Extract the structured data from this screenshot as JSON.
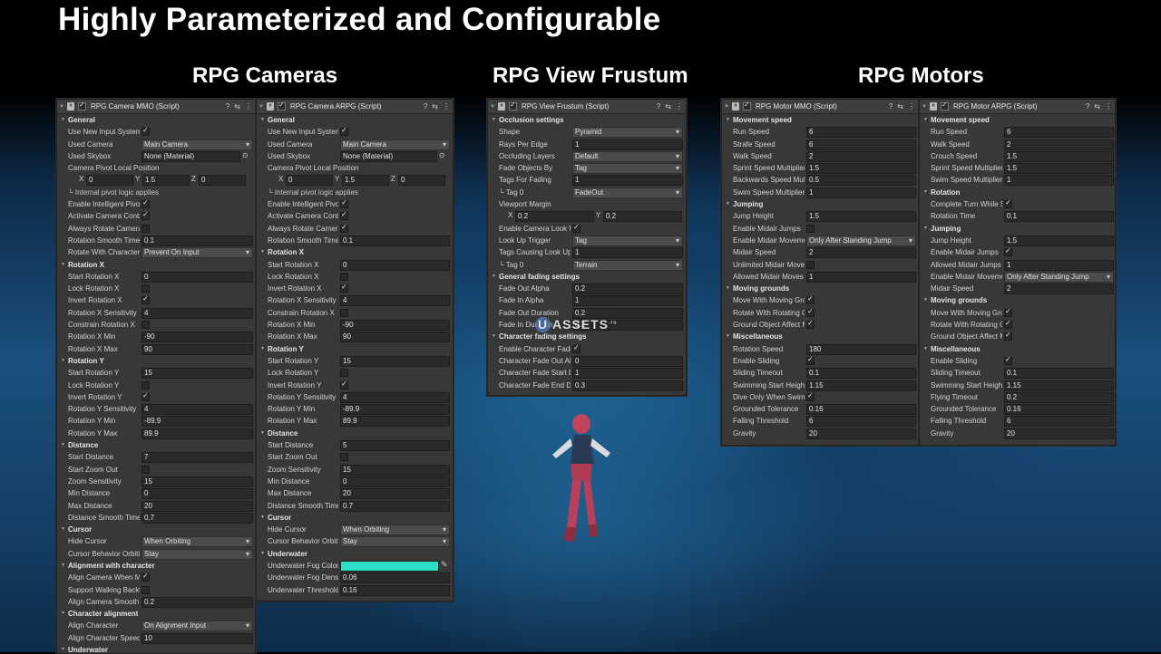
{
  "page": {
    "title": "Highly Parameterized and Configurable",
    "sections": [
      "RPG Cameras",
      "RPG View Frustum",
      "RPG Motors"
    ]
  },
  "colors": {
    "panel_bg": "#383838",
    "field_bg": "#2a2a2a",
    "underwater_fog_color": "#2ee0c8"
  },
  "icons": {
    "header": [
      "help-icon",
      "preset-icon",
      "menu-icon"
    ]
  },
  "watermark": {
    "u": "U",
    "text": "ASSETS",
    "sup": ".ru"
  },
  "panels": [
    {
      "name": "camera-mmo",
      "title": "RPG Camera MMO (Script)",
      "rows": [
        {
          "t": "head",
          "label": "General"
        },
        {
          "t": "check",
          "label": "Use New Input System",
          "on": true
        },
        {
          "t": "drop",
          "label": "Used Camera",
          "value": "Main Camera"
        },
        {
          "t": "obj",
          "label": "Used Skybox",
          "value": "None (Material)"
        },
        {
          "t": "label",
          "label": "Camera Pivot Local Position"
        },
        {
          "t": "xyz",
          "x": "0",
          "y": "1.5",
          "z": "0"
        },
        {
          "t": "sub",
          "label": "└ Internal pivot logic applies"
        },
        {
          "t": "check",
          "label": "Enable Intelligent Pivot",
          "on": true
        },
        {
          "t": "check",
          "label": "Activate Camera Control",
          "on": true
        },
        {
          "t": "check",
          "label": "Always Rotate Camera",
          "on": false
        },
        {
          "t": "field",
          "label": "Rotation Smooth Time",
          "value": "0.1"
        },
        {
          "t": "drop",
          "label": "Rotate With Character",
          "value": "Prevent On Input"
        },
        {
          "t": "head",
          "label": "Rotation X"
        },
        {
          "t": "field",
          "label": "Start Rotation X",
          "value": "0"
        },
        {
          "t": "check",
          "label": "Lock Rotation X",
          "on": false
        },
        {
          "t": "check",
          "label": "Invert Rotation X",
          "on": true
        },
        {
          "t": "field",
          "label": "Rotation X Sensitivity",
          "value": "4"
        },
        {
          "t": "check",
          "label": "Constrain Rotation X",
          "on": false
        },
        {
          "t": "field",
          "label": "Rotation X Min",
          "value": "-90"
        },
        {
          "t": "field",
          "label": "Rotation X Max",
          "value": "90"
        },
        {
          "t": "head",
          "label": "Rotation Y"
        },
        {
          "t": "field",
          "label": "Start Rotation Y",
          "value": "15"
        },
        {
          "t": "check",
          "label": "Lock Rotation Y",
          "on": false
        },
        {
          "t": "check",
          "label": "Invert Rotation Y",
          "on": true
        },
        {
          "t": "field",
          "label": "Rotation Y Sensitivity",
          "value": "4"
        },
        {
          "t": "field",
          "label": "Rotation Y Min",
          "value": "-89.9"
        },
        {
          "t": "field",
          "label": "Rotation Y Max",
          "value": "89.9"
        },
        {
          "t": "head",
          "label": "Distance"
        },
        {
          "t": "field",
          "label": "Start Distance",
          "value": "7"
        },
        {
          "t": "check",
          "label": "Start Zoom Out",
          "on": false
        },
        {
          "t": "field",
          "label": "Zoom Sensitivity",
          "value": "15"
        },
        {
          "t": "field",
          "label": "Min Distance",
          "value": "0"
        },
        {
          "t": "field",
          "label": "Max Distance",
          "value": "20"
        },
        {
          "t": "field",
          "label": "Distance Smooth Time",
          "value": "0.7"
        },
        {
          "t": "head",
          "label": "Cursor"
        },
        {
          "t": "drop",
          "label": "Hide Cursor",
          "value": "When Orbiting"
        },
        {
          "t": "drop",
          "label": "Cursor Behavior Orbiting",
          "value": "Stay"
        },
        {
          "t": "head",
          "label": "Alignment with character"
        },
        {
          "t": "check",
          "label": "Align Camera When Moving",
          "on": true
        },
        {
          "t": "check",
          "label": "Support Walking Backwards",
          "on": false
        },
        {
          "t": "field",
          "label": "Align Camera Smooth Time",
          "value": "0.2"
        },
        {
          "t": "head",
          "label": "Character alignment"
        },
        {
          "t": "drop",
          "label": "Align Character",
          "value": "On Alignment Input"
        },
        {
          "t": "field",
          "label": "Align Character Speed",
          "value": "10"
        },
        {
          "t": "head",
          "label": "Underwater"
        }
      ]
    },
    {
      "name": "camera-arpg",
      "title": "RPG Camera ARPG (Script)",
      "rows": [
        {
          "t": "head",
          "label": "General"
        },
        {
          "t": "check",
          "label": "Use New Input System",
          "on": true
        },
        {
          "t": "drop",
          "label": "Used Camera",
          "value": "Main Camera"
        },
        {
          "t": "obj",
          "label": "Used Skybox",
          "value": "None (Material)"
        },
        {
          "t": "label",
          "label": "Camera Pivot Local Position"
        },
        {
          "t": "xyz",
          "x": "0",
          "y": "1.5",
          "z": "0"
        },
        {
          "t": "sub",
          "label": "└ Internal pivot logic applies"
        },
        {
          "t": "check",
          "label": "Enable Intelligent Pivot",
          "on": true
        },
        {
          "t": "check",
          "label": "Activate Camera Control",
          "on": true
        },
        {
          "t": "check",
          "label": "Always Rotate Camera",
          "on": true
        },
        {
          "t": "field",
          "label": "Rotation Smooth Time",
          "value": "0.1"
        },
        {
          "t": "head",
          "label": "Rotation X"
        },
        {
          "t": "field",
          "label": "Start Rotation X",
          "value": "0"
        },
        {
          "t": "check",
          "label": "Lock Rotation X",
          "on": false
        },
        {
          "t": "check",
          "label": "Invert Rotation X",
          "on": true
        },
        {
          "t": "field",
          "label": "Rotation X Sensitivity",
          "value": "4"
        },
        {
          "t": "check",
          "label": "Constrain Rotation X",
          "on": false
        },
        {
          "t": "field",
          "label": "Rotation X Min",
          "value": "-90"
        },
        {
          "t": "field",
          "label": "Rotation X Max",
          "value": "90"
        },
        {
          "t": "head",
          "label": "Rotation Y"
        },
        {
          "t": "field",
          "label": "Start Rotation Y",
          "value": "15"
        },
        {
          "t": "check",
          "label": "Lock Rotation Y",
          "on": false
        },
        {
          "t": "check",
          "label": "Invert Rotation Y",
          "on": true
        },
        {
          "t": "field",
          "label": "Rotation Y Sensitivity",
          "value": "4"
        },
        {
          "t": "field",
          "label": "Rotation Y Min",
          "value": "-89.9"
        },
        {
          "t": "field",
          "label": "Rotation Y Max",
          "value": "89.9"
        },
        {
          "t": "head",
          "label": "Distance"
        },
        {
          "t": "field",
          "label": "Start Distance",
          "value": "5"
        },
        {
          "t": "check",
          "label": "Start Zoom Out",
          "on": false
        },
        {
          "t": "field",
          "label": "Zoom Sensitivity",
          "value": "15"
        },
        {
          "t": "field",
          "label": "Min Distance",
          "value": "0"
        },
        {
          "t": "field",
          "label": "Max Distance",
          "value": "20"
        },
        {
          "t": "field",
          "label": "Distance Smooth Time",
          "value": "0.7"
        },
        {
          "t": "head",
          "label": "Cursor"
        },
        {
          "t": "drop",
          "label": "Hide Cursor",
          "value": "When Orbiting"
        },
        {
          "t": "drop",
          "label": "Cursor Behavior Orbiting",
          "value": "Stay"
        },
        {
          "t": "head",
          "label": "Underwater"
        },
        {
          "t": "color",
          "label": "Underwater Fog Color"
        },
        {
          "t": "field",
          "label": "Underwater Fog Density",
          "value": "0.06"
        },
        {
          "t": "field",
          "label": "Underwater Threshold",
          "value": "0.16"
        }
      ]
    },
    {
      "name": "view-frustum",
      "title": "RPG View Frustum (Script)",
      "rows": [
        {
          "t": "head",
          "label": "Occlusion settings"
        },
        {
          "t": "drop",
          "label": "Shape",
          "value": "Pyramid"
        },
        {
          "t": "field",
          "label": "Rays Per Edge",
          "value": "1"
        },
        {
          "t": "drop",
          "label": "Occluding Layers",
          "value": "Default"
        },
        {
          "t": "drop",
          "label": "Fade Objects By",
          "value": "Tag"
        },
        {
          "t": "field",
          "label": "Tags For Fading",
          "value": "1"
        },
        {
          "t": "drop",
          "label": "└ Tag 0",
          "value": "FadeOut"
        },
        {
          "t": "label",
          "label": "Viewport Margin"
        },
        {
          "t": "xy",
          "x": "0.2",
          "y": "0.2"
        },
        {
          "t": "check",
          "label": "Enable Camera Look Up",
          "on": true
        },
        {
          "t": "drop",
          "label": "Look Up Trigger",
          "value": "Tag"
        },
        {
          "t": "field",
          "label": "Tags Causing Look Up",
          "value": "1"
        },
        {
          "t": "drop",
          "label": "└ Tag 0",
          "value": "Terrain"
        },
        {
          "t": "head",
          "label": "General fading settings"
        },
        {
          "t": "field",
          "label": "Fade Out Alpha",
          "value": "0.2"
        },
        {
          "t": "field",
          "label": "Fade In Alpha",
          "value": "1"
        },
        {
          "t": "field",
          "label": "Fade Out Duration",
          "value": "0.2"
        },
        {
          "t": "field",
          "label": "Fade In Duration",
          "value": "0.2"
        },
        {
          "t": "head",
          "label": "Character fading settings"
        },
        {
          "t": "check",
          "label": "Enable Character Fading",
          "on": true
        },
        {
          "t": "field",
          "label": "Character Fade Out Alpha",
          "value": "0"
        },
        {
          "t": "field",
          "label": "Character Fade Start Distance",
          "value": "1"
        },
        {
          "t": "field",
          "label": "Character Fade End Distance",
          "value": "0.3"
        }
      ]
    },
    {
      "name": "motor-mmo",
      "title": "RPG Motor MMO (Script)",
      "rows": [
        {
          "t": "head",
          "label": "Movement speed"
        },
        {
          "t": "field",
          "label": "Run Speed",
          "value": "6"
        },
        {
          "t": "field",
          "label": "Strafe Speed",
          "value": "6"
        },
        {
          "t": "field",
          "label": "Walk Speed",
          "value": "2"
        },
        {
          "t": "field",
          "label": "Sprint Speed Multiplier",
          "value": "1.5"
        },
        {
          "t": "field",
          "label": "Backwards Speed Multiplier",
          "value": "0.5"
        },
        {
          "t": "field",
          "label": "Swim Speed Multiplier",
          "value": "1"
        },
        {
          "t": "head",
          "label": "Jumping"
        },
        {
          "t": "field",
          "label": "Jump Height",
          "value": "1.5"
        },
        {
          "t": "check",
          "label": "Enable Midair Jumps",
          "on": false
        },
        {
          "t": "drop",
          "label": "Enable Midair Movement",
          "value": "Only After Standing Jump"
        },
        {
          "t": "field",
          "label": "Midair Speed",
          "value": "2"
        },
        {
          "t": "check",
          "label": "Unlimited Midair Moves",
          "on": false
        },
        {
          "t": "field",
          "label": "Allowed Midair Moves",
          "value": "1"
        },
        {
          "t": "head",
          "label": "Moving grounds"
        },
        {
          "t": "check",
          "label": "Move With Moving Ground",
          "on": true
        },
        {
          "t": "check",
          "label": "Rotate With Rotating Ground",
          "on": true
        },
        {
          "t": "check",
          "label": "Ground Object Affect Me",
          "on": true
        },
        {
          "t": "head",
          "label": "Miscellaneous"
        },
        {
          "t": "field",
          "label": "Rotation Speed",
          "value": "180"
        },
        {
          "t": "check",
          "label": "Enable Sliding",
          "on": true
        },
        {
          "t": "field",
          "label": "Sliding Timeout",
          "value": "0.1"
        },
        {
          "t": "field",
          "label": "Swimming Start Height",
          "value": "1.15"
        },
        {
          "t": "check",
          "label": "Dive Only When Swim Forward",
          "on": true
        },
        {
          "t": "field",
          "label": "Grounded Tolerance",
          "value": "0.16"
        },
        {
          "t": "field",
          "label": "Falling Threshold",
          "value": "6"
        },
        {
          "t": "field",
          "label": "Gravity",
          "value": "20"
        }
      ]
    },
    {
      "name": "motor-arpg",
      "title": "RPG Motor ARPG (Script)",
      "rows": [
        {
          "t": "head",
          "label": "Movement speed"
        },
        {
          "t": "field",
          "label": "Run Speed",
          "value": "6"
        },
        {
          "t": "field",
          "label": "Walk Speed",
          "value": "2"
        },
        {
          "t": "field",
          "label": "Crouch Speed",
          "value": "1.5"
        },
        {
          "t": "field",
          "label": "Sprint Speed Multiplier",
          "value": "1.5"
        },
        {
          "t": "field",
          "label": "Swim Speed Multiplier",
          "value": "1"
        },
        {
          "t": "head",
          "label": "Rotation"
        },
        {
          "t": "check",
          "label": "Complete Turn While Standing",
          "on": true
        },
        {
          "t": "field",
          "label": "Rotation Time",
          "value": "0.1"
        },
        {
          "t": "head",
          "label": "Jumping"
        },
        {
          "t": "field",
          "label": "Jump Height",
          "value": "1.5"
        },
        {
          "t": "check",
          "label": "Enable Midair Jumps",
          "on": true
        },
        {
          "t": "field",
          "label": "Allowed Midair Jumps",
          "value": "1"
        },
        {
          "t": "drop",
          "label": "Enable Midair Movement",
          "value": "Only After Standing Jump"
        },
        {
          "t": "field",
          "label": "Midair Speed",
          "value": "2"
        },
        {
          "t": "head",
          "label": "Moving grounds"
        },
        {
          "t": "check",
          "label": "Move With Moving Ground",
          "on": true
        },
        {
          "t": "check",
          "label": "Rotate With Rotating Ground",
          "on": true
        },
        {
          "t": "check",
          "label": "Ground Object Affect Me",
          "on": true
        },
        {
          "t": "head",
          "label": "Miscellaneous"
        },
        {
          "t": "check",
          "label": "Enable Sliding",
          "on": true
        },
        {
          "t": "field",
          "label": "Sliding Timeout",
          "value": "0.1"
        },
        {
          "t": "field",
          "label": "Swimming Start Height",
          "value": "1.15"
        },
        {
          "t": "field",
          "label": "Flying Timeout",
          "value": "0.2"
        },
        {
          "t": "field",
          "label": "Grounded Tolerance",
          "value": "0.16"
        },
        {
          "t": "field",
          "label": "Falling Threshold",
          "value": "6"
        },
        {
          "t": "field",
          "label": "Gravity",
          "value": "20"
        }
      ]
    }
  ]
}
